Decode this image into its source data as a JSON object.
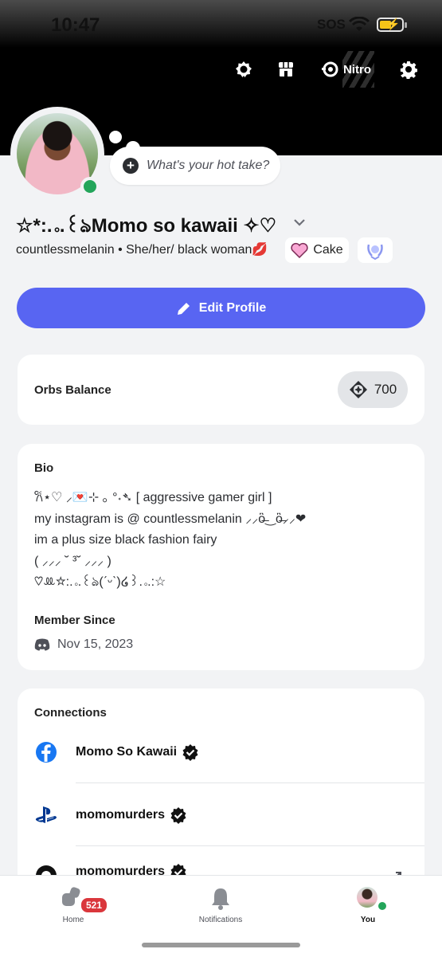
{
  "status_bar": {
    "time": "10:47",
    "sos": "SOS"
  },
  "top_bar": {
    "nitro_label": "Nitro"
  },
  "hot_take": {
    "placeholder": "What's your hot take?"
  },
  "profile": {
    "display_name": "☆*:.｡.꒰ঌMomo so kawaii ✧♡",
    "username_line": "countlessmelanin • She/her/ black woman💋",
    "badges": {
      "cake_label": "Cake"
    }
  },
  "edit_profile": {
    "label": "Edit Profile"
  },
  "orbs": {
    "label": "Orbs Balance",
    "balance": "700"
  },
  "bio": {
    "title": "Bio",
    "lines": [
      "𐙚⋆♡ ⸝💌⊹ ｡ °˖➴ [ aggressive gamer girl ]",
      "my instagram is @ countlessmelanin ⸝⸝ὃ̶‿ὃ̶⸝⸝❤",
      "im a plus size black fashion fairy",
      "( ⸝⸝⸝ ˘ ³˘ ⸝⸝⸝ )",
      "♡ꔛ☆:.｡.꒰ঌ(ˊᵕˋ)໒꒱.｡.:☆"
    ],
    "member_since_title": "Member Since",
    "member_since_date": "Nov 15, 2023"
  },
  "connections": {
    "title": "Connections",
    "items": [
      {
        "platform": "facebook",
        "name": "Momo So Kawaii"
      },
      {
        "platform": "playstation",
        "name": "momomurders"
      },
      {
        "platform": "other",
        "name": "momomurders"
      }
    ]
  },
  "tabbar": {
    "home_label": "Home",
    "home_badge": "521",
    "notifications_label": "Notifications",
    "you_label": "You"
  },
  "colors": {
    "accent": "#5865f2",
    "online": "#23a55a",
    "badge_red": "#da373c"
  }
}
